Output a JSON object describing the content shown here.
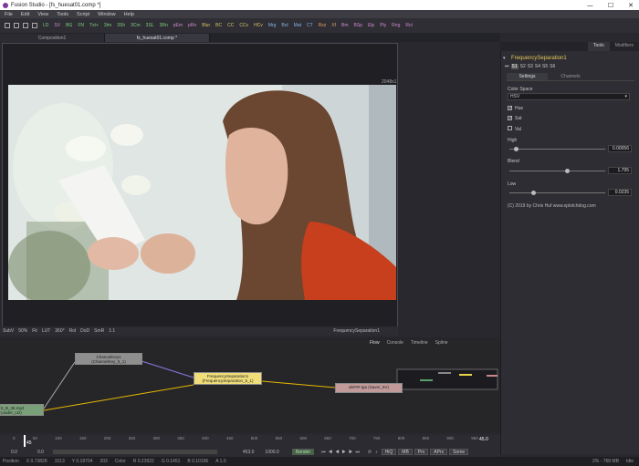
{
  "window": {
    "title": "Fusion Studio - [fs_huesat01.comp *]"
  },
  "menu": [
    "File",
    "Edit",
    "View",
    "Tools",
    "Script",
    "Window",
    "Help"
  ],
  "toolbar": [
    "LD",
    "SV",
    "BG",
    "FN",
    "Txt+",
    "3Im",
    "3Sh",
    "3Cm",
    "3SL",
    "3Rn",
    "pEm",
    "pRn",
    "Blur",
    "BC",
    "CC",
    "CCv",
    "HCv",
    "Mrg",
    "Bol",
    "Mat",
    "CT",
    "Rsz",
    "Xf",
    "Bm",
    "BSp",
    "Elp",
    "Ply",
    "Rng",
    "Rct"
  ],
  "tabs": [
    "Composition1",
    "fs_huesat01.comp *"
  ],
  "viewer": {
    "resolution": "2048x1",
    "tool_label": "FrequencySeparation1",
    "bar": [
      "SubV",
      "50%",
      "Fit",
      "LUT",
      "360°",
      "Rol",
      "DoD",
      "SmR",
      "1:1"
    ]
  },
  "right_panel": {
    "tabs": [
      "Tools",
      "Modifiers"
    ],
    "tool_name": "FrequencySeparation1",
    "sub_tabs": [
      "S1",
      "S2",
      "S3",
      "S4",
      "S5",
      "S6"
    ],
    "inner_tabs": [
      "Settings",
      "Channels"
    ],
    "color_space_label": "Color Space",
    "color_space_value": "HSV",
    "checks": [
      {
        "label": "Hue",
        "checked": true
      },
      {
        "label": "Sat",
        "checked": true
      },
      {
        "label": "Val",
        "checked": false
      }
    ],
    "sliders": [
      {
        "label": "High",
        "value": "0.00056",
        "pos": 0.05
      },
      {
        "label": "Blend",
        "value": "1.795",
        "pos": 0.6
      },
      {
        "label": "Low",
        "value": "0.0235",
        "pos": 0.25
      }
    ],
    "credit": "(C) 2019 by Chris Huf www.splotchdog.com"
  },
  "flow": {
    "tabs": [
      "Flow",
      "Console",
      "Timeline",
      "Spline"
    ],
    "nodes": [
      {
        "name": "ChannelKey1\n(ChannelKey_5_1)"
      },
      {
        "name": "FrequencySeparation1\n(FrequencySeparation_5_1)"
      },
      {
        "name": "ab###.tga (Saver_5V)"
      },
      {
        "name": "5_B_36.mp4\n(oader_LD)"
      }
    ]
  },
  "timeline": {
    "ticks": [
      "0",
      "50",
      "100",
      "150",
      "200",
      "250",
      "300",
      "350",
      "400",
      "450",
      "500",
      "550",
      "600",
      "650",
      "700",
      "750",
      "800",
      "850",
      "900",
      "950"
    ],
    "current": "45",
    "end": "45.0"
  },
  "transport": {
    "start": "0.0",
    "s2": "0.0",
    "f1": "453.0",
    "f2": "1000.0",
    "render_label": "Render",
    "hiq": "HiQ",
    "mb": "MB",
    "prx": "Prx",
    "aprx": "APrx",
    "some": "Some"
  },
  "status": {
    "position": "Position",
    "x": "X 0.73828",
    "n1": "1513",
    "y": "Y 0.18704",
    "n2": "203",
    "color": "Color",
    "r": "R 0.23922",
    "g": "G 0.1451",
    "b": "B 0.10196",
    "a": "A 1.0",
    "mem": "2% - 768 MB",
    "state": "Idle"
  }
}
